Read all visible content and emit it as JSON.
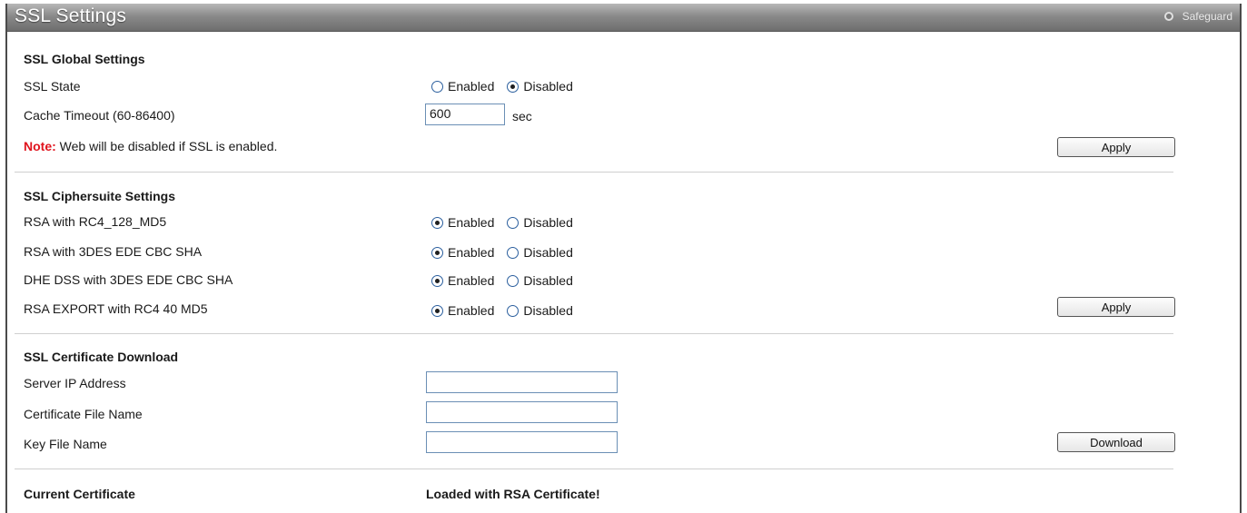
{
  "title": "SSL Settings",
  "safeguard_label": "Safeguard",
  "global": {
    "heading": "SSL Global Settings",
    "ssl_state_label": "SSL State",
    "ssl_state_options": [
      "Enabled",
      "Disabled"
    ],
    "ssl_state_selected": "Disabled",
    "cache_timeout_label": "Cache Timeout (60-86400)",
    "cache_timeout_value": "600",
    "cache_timeout_unit": "sec",
    "note_prefix": "Note:",
    "note_text": " Web will be disabled if SSL is enabled.",
    "apply_label": "Apply"
  },
  "ciphersuite": {
    "heading": "SSL Ciphersuite Settings",
    "rows": [
      {
        "label": "RSA with RC4_128_MD5",
        "enabled": "Enabled",
        "disabled": "Disabled",
        "selected": "Enabled"
      },
      {
        "label": "RSA with 3DES EDE CBC SHA",
        "enabled": "Enabled",
        "disabled": "Disabled",
        "selected": "Enabled"
      },
      {
        "label": "DHE DSS with 3DES EDE CBC SHA",
        "enabled": "Enabled",
        "disabled": "Disabled",
        "selected": "Enabled"
      },
      {
        "label": "RSA EXPORT with RC4 40 MD5",
        "enabled": "Enabled",
        "disabled": "Disabled",
        "selected": "Enabled"
      }
    ],
    "apply_label": "Apply"
  },
  "download": {
    "heading": "SSL Certificate Download",
    "server_ip_label": "Server IP Address",
    "server_ip_value": "",
    "cert_file_label": "Certificate File Name",
    "cert_file_value": "",
    "key_file_label": "Key File Name",
    "key_file_value": "",
    "download_label": "Download"
  },
  "current": {
    "label": "Current Certificate",
    "value": "Loaded with RSA Certificate!"
  }
}
